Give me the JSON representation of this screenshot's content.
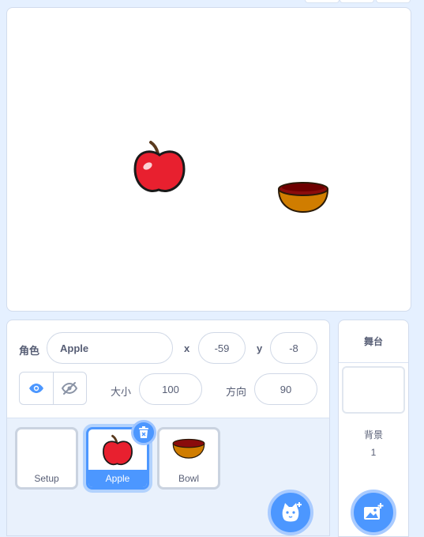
{
  "stage": {
    "sprites": [
      {
        "name": "Apple",
        "icon": "apple-icon"
      },
      {
        "name": "Bowl",
        "icon": "bowl-icon"
      }
    ]
  },
  "sprite_info": {
    "sprite_label": "角色",
    "sprite_name": "Apple",
    "x_label": "x",
    "x_value": "-59",
    "y_label": "y",
    "y_value": "-8",
    "size_label": "大小",
    "size_value": "100",
    "direction_label": "方向",
    "direction_value": "90",
    "show_icon": "eye-icon",
    "hide_icon": "eye-slash-icon"
  },
  "sprite_list": {
    "items": [
      {
        "name": "Setup",
        "selected": false
      },
      {
        "name": "Apple",
        "selected": true
      },
      {
        "name": "Bowl",
        "selected": false
      }
    ],
    "delete_icon": "trash-icon",
    "add_sprite_icon": "cat-add-icon"
  },
  "stage_panel": {
    "title": "舞台",
    "backdrops_label": "背景",
    "backdrops_count": "1",
    "add_backdrop_icon": "image-add-icon"
  },
  "colors": {
    "accent": "#4c97ff",
    "background": "#e5f0ff",
    "text": "#575e75"
  }
}
